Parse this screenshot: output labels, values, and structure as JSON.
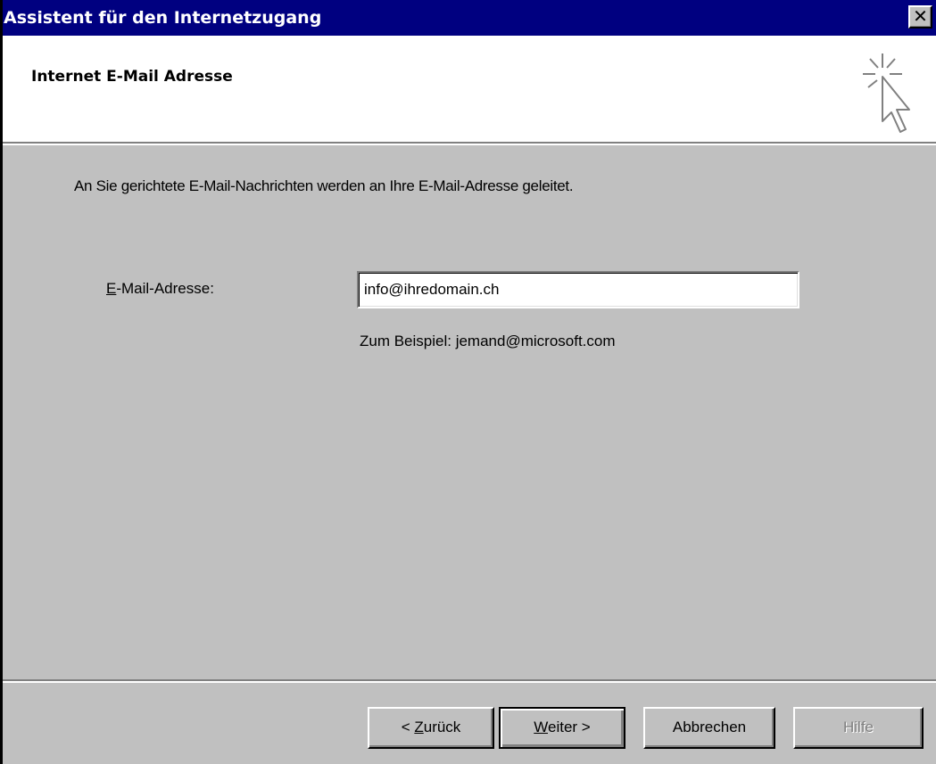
{
  "window": {
    "title": "Assistent für den Internetzugang",
    "close_label": "✕"
  },
  "header": {
    "title": "Internet E-Mail Adresse",
    "icon": "wizard-cursor-icon"
  },
  "main": {
    "description": "An Sie gerichtete E-Mail-Nachrichten werden an Ihre E-Mail-Adresse geleitet.",
    "email_label_accel": "E",
    "email_label_rest": "-Mail-Adresse:",
    "email_value": "info@ihredomain.ch",
    "hint": "Zum Beispiel: jemand@microsoft.com"
  },
  "buttons": {
    "back_prefix": "< ",
    "back_accel": "Z",
    "back_rest": "urück",
    "next_accel": "W",
    "next_rest": "eiter >",
    "cancel": "Abbrechen",
    "help": "Hilfe",
    "help_enabled": false
  },
  "colors": {
    "titlebar": "#000080",
    "face": "#c0c0c0",
    "header_bg": "#ffffff"
  }
}
